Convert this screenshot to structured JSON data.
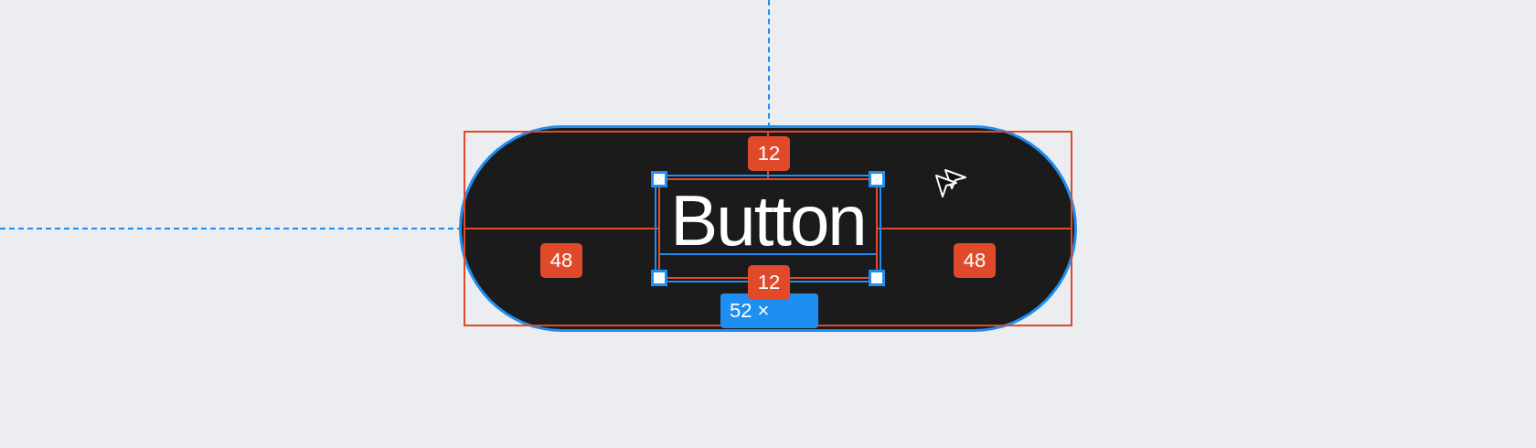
{
  "canvas": {
    "element": {
      "label": "Button",
      "selected": true
    },
    "spacing": [
      {
        "kind": "top",
        "value": "12"
      },
      {
        "kind": "left",
        "value": "48"
      },
      {
        "kind": "right",
        "value": "48"
      },
      {
        "kind": "bottom",
        "value": "12"
      }
    ],
    "size_label": "52 ×"
  }
}
